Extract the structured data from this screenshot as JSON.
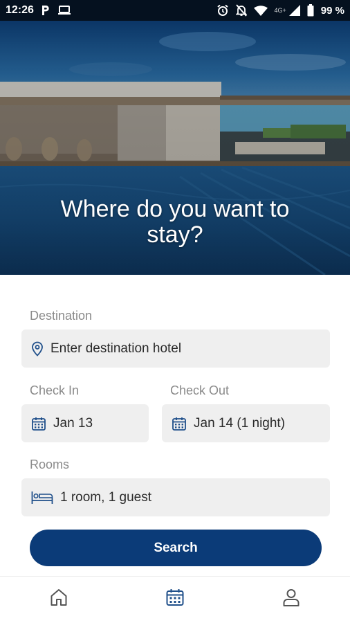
{
  "status_bar": {
    "time": "12:26",
    "network": "4G+",
    "battery": "99 %",
    "left_icons": [
      "parking-app-icon",
      "laptop-icon"
    ],
    "right_icons": [
      "alarm-icon",
      "notifications-off-icon",
      "wifi-icon",
      "signal-icon",
      "battery-icon"
    ]
  },
  "hero": {
    "title": "Where do you want to stay?"
  },
  "form": {
    "destination": {
      "label": "Destination",
      "placeholder": "Enter destination hotel",
      "icon": "location-pin-icon"
    },
    "check_in": {
      "label": "Check In",
      "value": "Jan 13",
      "icon": "calendar-icon"
    },
    "check_out": {
      "label": "Check Out",
      "value": "Jan 14 (1 night)",
      "icon": "calendar-icon"
    },
    "rooms": {
      "label": "Rooms",
      "value": "1 room, 1 guest",
      "icon": "bed-icon"
    },
    "search_label": "Search"
  },
  "bottom_nav": {
    "items": [
      {
        "icon": "home-icon",
        "active": false
      },
      {
        "icon": "calendar-icon",
        "active": true
      },
      {
        "icon": "profile-icon",
        "active": false
      }
    ]
  },
  "colors": {
    "brand": "#0b3b78",
    "input_bg": "#efefef",
    "label": "#8a8a8a",
    "icon": "#1f4f8a",
    "nav_inactive": "#555555"
  }
}
